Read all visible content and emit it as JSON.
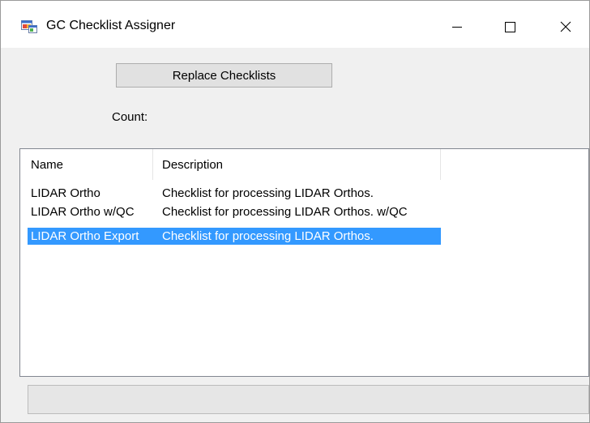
{
  "window": {
    "title": "GC Checklist Assigner",
    "icon": "windows-form-icon"
  },
  "toolbar": {
    "replace_label": "Replace Checklists",
    "count_label": "Count:"
  },
  "list": {
    "columns": [
      "Name",
      "Description"
    ],
    "rows": [
      {
        "name": "LIDAR Ortho",
        "description": "Checklist for processing LIDAR Orthos.",
        "selected": false
      },
      {
        "name": "LIDAR Ortho w/QC",
        "description": "Checklist for processing LIDAR Orthos. w/QC",
        "selected": false
      },
      {
        "name": "LIDAR Ortho Export",
        "description": "Checklist for processing LIDAR Orthos.",
        "selected": true
      }
    ]
  },
  "progress": {
    "value": 0
  },
  "colors": {
    "selection": "#3399ff",
    "window_bg": "#f0f0f0"
  }
}
